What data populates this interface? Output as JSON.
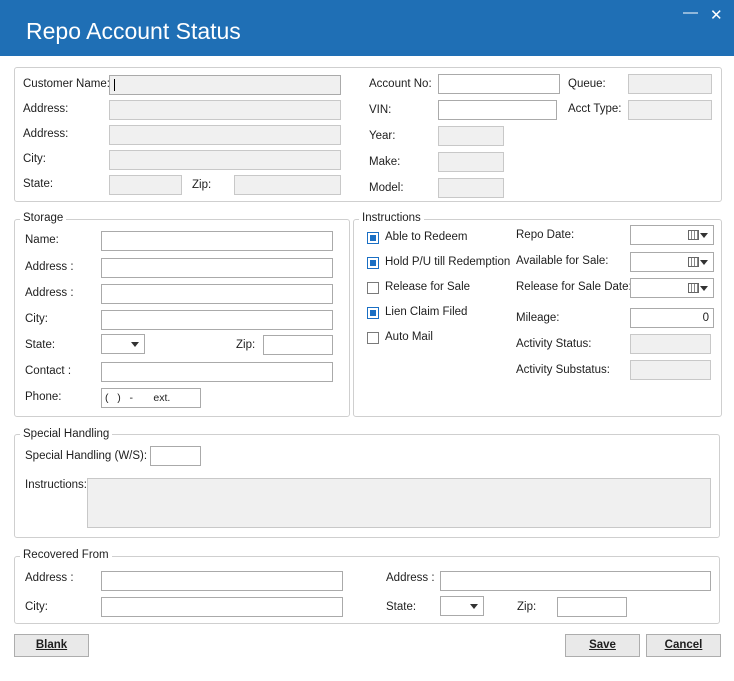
{
  "window": {
    "title": "Repo Account Status",
    "minimize_icon": "minimize-icon",
    "close_icon": "close-icon"
  },
  "customer": {
    "customer_name_label": "Customer Name:",
    "address1_label": "Address:",
    "address2_label": "Address:",
    "city_label": "City:",
    "state_label": "State:",
    "zip_label": "Zip:",
    "account_no_label": "Account No:",
    "vin_label": "VIN:",
    "year_label": "Year:",
    "make_label": "Make:",
    "model_label": "Model:",
    "queue_label": "Queue:",
    "acct_type_label": "Acct Type:"
  },
  "storage": {
    "group_label": "Storage",
    "name_label": "Name:",
    "address1_label": "Address :",
    "address2_label": "Address :",
    "city_label": "City:",
    "state_label": "State:",
    "zip_label": "Zip:",
    "contact_label": "Contact :",
    "phone_label": "Phone:",
    "phone_mask": "(   )   -       ext."
  },
  "instructions": {
    "group_label": "Instructions",
    "checkboxes": [
      {
        "label": "Able to Redeem",
        "checked": true
      },
      {
        "label": "Hold P/U till Redemption",
        "checked": true
      },
      {
        "label": "Release for Sale",
        "checked": false
      },
      {
        "label": "Lien Claim Filed",
        "checked": true
      },
      {
        "label": "Auto Mail",
        "checked": false
      }
    ],
    "repo_date_label": "Repo Date:",
    "available_for_sale_label": "Available for Sale:",
    "release_for_sale_date_label": "Release for Sale Date:",
    "mileage_label": "Mileage:",
    "mileage_value": "0",
    "activity_status_label": "Activity Status:",
    "activity_substatus_label": "Activity Substatus:"
  },
  "special_handling": {
    "group_label": "Special Handling",
    "ws_label": "Special Handling (W/S):",
    "instructions_label": "Instructions:"
  },
  "recovered_from": {
    "group_label": "Recovered From",
    "address1_label": "Address :",
    "address2_label": "Address :",
    "city_label": "City:",
    "state_label": "State:",
    "zip_label": "Zip:"
  },
  "buttons": {
    "blank": "Blank",
    "save": "Save",
    "cancel": "Cancel"
  }
}
